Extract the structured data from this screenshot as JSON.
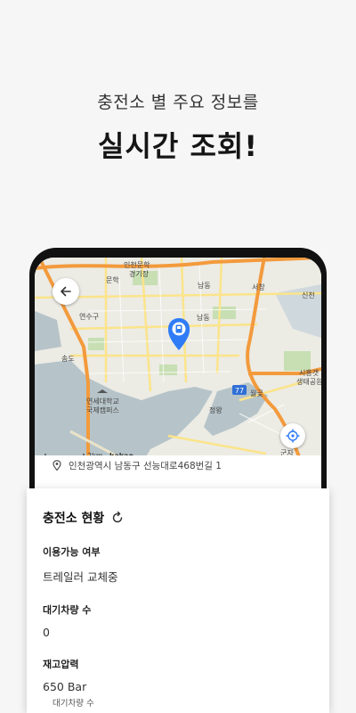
{
  "headline": {
    "subtitle": "충전소 별 주요 정보를",
    "title": "실시간 조회!"
  },
  "map": {
    "labels": {
      "munhak": "인천문학\n경기장",
      "munhak_short": "문학",
      "namdong_top": "남동",
      "seochang": "서창",
      "incheon_right": "신천",
      "yeonsugu": "연수구",
      "namdong_mid": "남동",
      "songdo": "송도",
      "yonsei1": "연세대학교",
      "yonsei2": "국제캠퍼스",
      "siheung1": "시흥갯",
      "siheung2": "생태공원",
      "wolgot": "월곶",
      "jeongwang": "정왕",
      "gunja": "군자",
      "route": "77",
      "scale": "2km",
      "brand": "kakao"
    },
    "colors": {
      "water": "#b6c4c9",
      "land": "#ecebe4",
      "highway": "#f39a3c",
      "road": "#fbe48a",
      "park": "#c7dfb3",
      "marker": "#2f7cf6"
    }
  },
  "address": "인천광역시 남동구 선능대로468번길 1",
  "card": {
    "title": "충전소 현황",
    "fields": [
      {
        "label": "이용가능 여부",
        "value": "트레일러 교체중"
      },
      {
        "label": "대기차량 수",
        "value": "0"
      },
      {
        "label": "재고압력",
        "value": "650 Bar"
      }
    ],
    "peek_label": "대기차량 수"
  }
}
